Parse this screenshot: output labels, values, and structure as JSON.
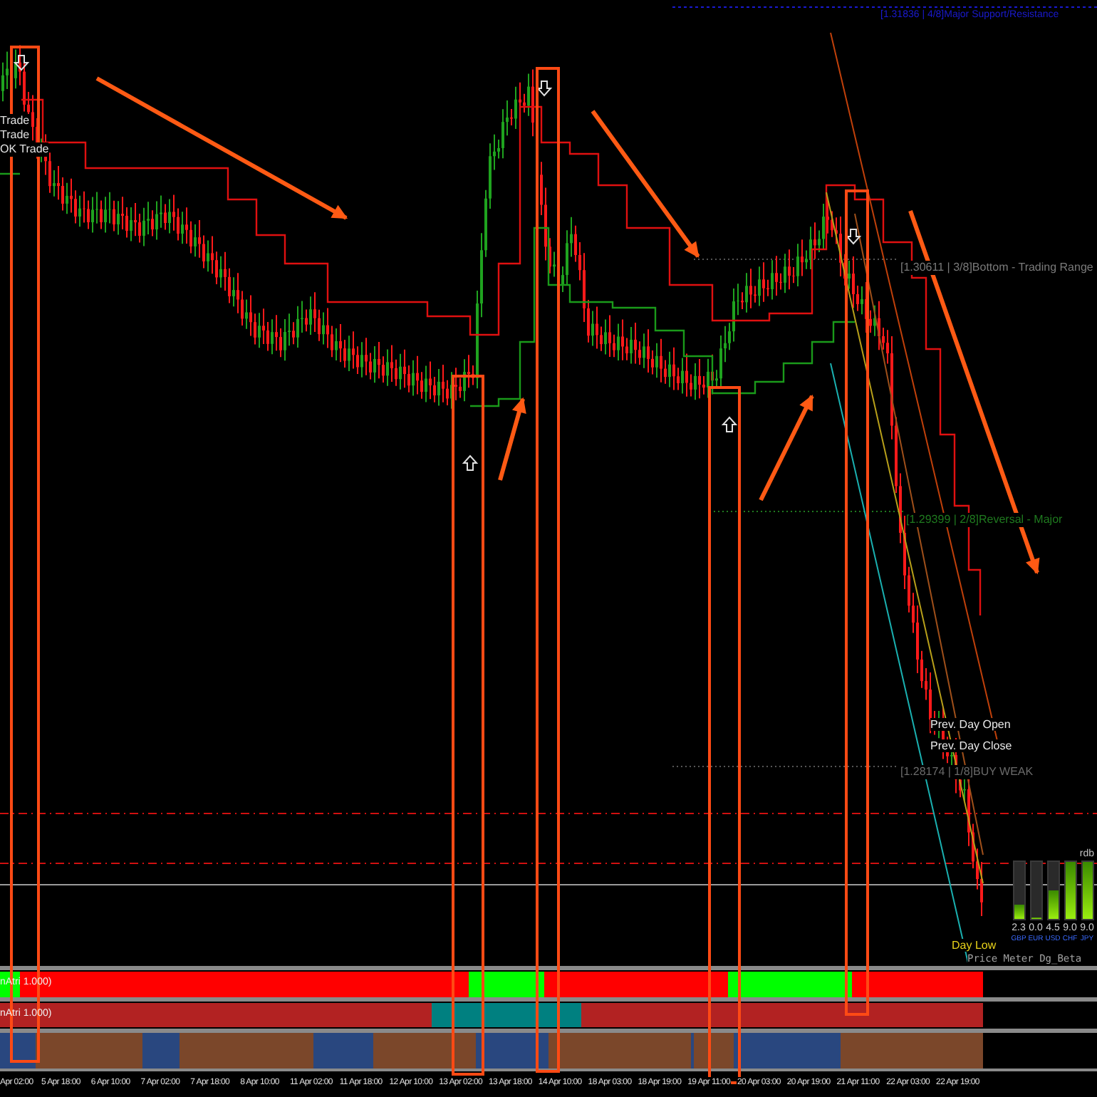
{
  "chart": {
    "level_labels": [
      {
        "text": "[1.31836 | 4/8]Major Support/Resistance",
        "kind": "major"
      },
      {
        "text": "[1.30611 | 3/8]Bottom - Trading Range",
        "kind": "bottom"
      },
      {
        "text": "[1.29399 | 2/8]Reversal - Major",
        "kind": "reversal"
      },
      {
        "text": "[1.28174 | 1/8]BUY WEAK",
        "kind": "weak"
      }
    ],
    "signal_labels": [
      "Trade",
      "Trade",
      "OK Trade"
    ],
    "day_labels": [
      {
        "text": "Prev. Day Open",
        "kind": "open"
      },
      {
        "text": "Prev. Day Close",
        "kind": "close"
      },
      {
        "text": "Day Low",
        "kind": "low"
      }
    ]
  },
  "price_meter": {
    "label": "rdb",
    "title": "Price Meter Dg_Beta",
    "currencies": [
      {
        "code": "GBP",
        "level": 0.26,
        "reading": "2.3"
      },
      {
        "code": "EUR",
        "level": 0,
        "reading": "0.0"
      },
      {
        "code": "USD",
        "level": 0.5,
        "reading": "4.5"
      },
      {
        "code": "CHF",
        "level": 1,
        "reading": "9.0"
      },
      {
        "code": "JPY",
        "level": 1,
        "reading": "9.0"
      }
    ]
  },
  "indicator_panes": [
    {
      "label": "nAtri 1.000)"
    },
    {
      "label": "nAtri 1.000)"
    }
  ],
  "time_axis": [
    "Apr 02:00",
    "5 Apr 18:00",
    "6 Apr 10:00",
    "7 Apr 02:00",
    "7 Apr 18:00",
    "8 Apr 10:00",
    "11 Apr 02:00",
    "11 Apr 18:00",
    "12 Apr 10:00",
    "13 Apr 02:00",
    "13 Apr 18:00",
    "14 Apr 10:00",
    "18 Apr 03:00",
    "18 Apr 19:00",
    "19 Apr 11:00",
    "20 Apr 03:00",
    "20 Apr 19:00",
    "21 Apr 11:00",
    "22 Apr 03:00",
    "22 Apr 19:00"
  ]
}
